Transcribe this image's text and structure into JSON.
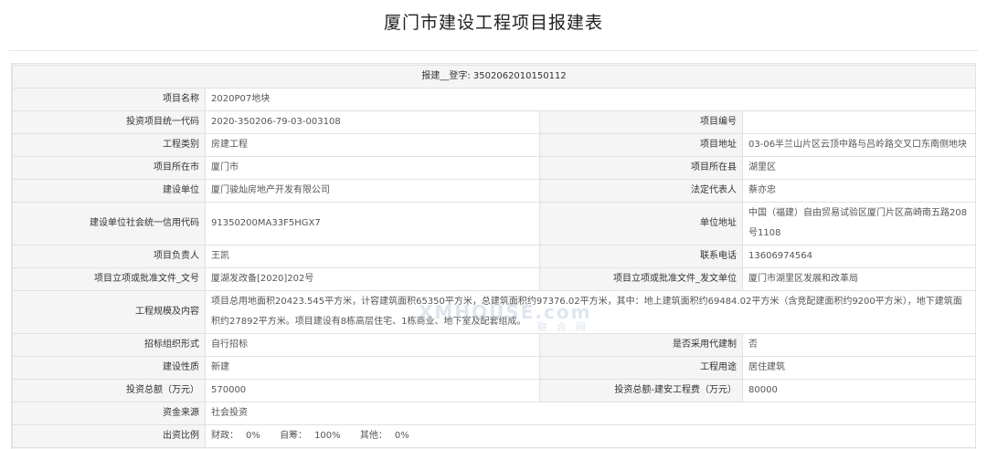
{
  "page_title": "厦门市建设工程项目报建表",
  "registration_header": "报建__登字: 3502062010150112",
  "fields": {
    "project_name_label": "项目名称",
    "project_name": "2020P07地块",
    "unified_code_label": "投资项目统一代码",
    "unified_code": "2020-350206-79-03-003108",
    "project_number_label": "项目编号",
    "project_number": "",
    "category_label": "工程类别",
    "category": "房建工程",
    "address_label": "项目地址",
    "address": "03-06半兰山片区云顶中路与吕岭路交叉口东南侧地块",
    "city_label": "项目所在市",
    "city": "厦门市",
    "county_label": "项目所在县",
    "county": "湖里区",
    "builder_label": "建设单位",
    "builder": "厦门骏灿房地产开发有限公司",
    "legal_rep_label": "法定代表人",
    "legal_rep": "蔡亦忠",
    "credit_code_label": "建设单位社会统一信用代码",
    "credit_code": "91350200MA33F5HGX7",
    "unit_address_label": "单位地址",
    "unit_address": "中国（福建）自由贸易试验区厦门片区高崎南五路208号1108",
    "manager_label": "项目负责人",
    "manager": "王凯",
    "phone_label": "联系电话",
    "phone": "13606974564",
    "approval_doc_label": "项目立项或批准文件_文号",
    "approval_doc": "厦湖发改备[2020]202号",
    "approval_unit_label": "项目立项或批准文件_发文单位",
    "approval_unit": "厦门市湖里区发展和改革局",
    "scale_label": "工程规模及内容",
    "scale": "项目总用地面积20423.545平方米，计容建筑面积65350平方米，总建筑面积约97376.02平方米，其中：地上建筑面积约69484.02平方米（含竞配建面积约9200平方米），地下建筑面积约27892平方米。项目建设有8栋高层住宅、1栋商业、地下室及配套组成。",
    "bidding_form_label": "招标组织形式",
    "bidding_form": "自行招标",
    "agent_label": "是否采用代建制",
    "agent": "否",
    "nature_label": "建设性质",
    "nature": "新建",
    "usage_label": "工程用途",
    "usage": "居住建筑",
    "total_invest_label": "投资总额（万元）",
    "total_invest": "570000",
    "install_fee_label": "投资总额-建安工程费（万元）",
    "install_fee": "80000",
    "fund_source_label": "资金来源",
    "fund_source": "社会投资",
    "ratio_label": "出资比例",
    "ratio": {
      "fiscal_label": "财政：",
      "fiscal": "0%",
      "self_label": "自筹：",
      "self": "100%",
      "other_label": "其他：",
      "other": "0%"
    }
  },
  "watermark": {
    "main": "XMHOUSE.com",
    "sub": "联合网"
  }
}
